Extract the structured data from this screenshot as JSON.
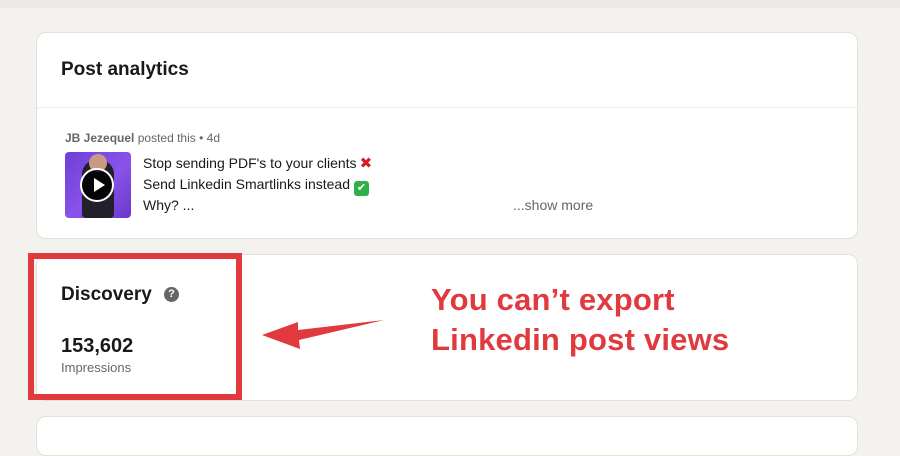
{
  "post_analytics": {
    "title": "Post analytics",
    "post": {
      "author": "JB Jezequel",
      "action": "posted this",
      "separator": "•",
      "age": "4d",
      "lines": [
        "Stop sending PDF's to your clients",
        "Send Linkedin Smartlinks instead",
        "Why? ..."
      ],
      "emoji_line1": "✖",
      "emoji_line2": "✔",
      "show_more": "...show more",
      "thumbnail_icon": "play-icon"
    }
  },
  "discovery": {
    "title": "Discovery",
    "help_icon": "?",
    "metric": {
      "value": "153,602",
      "label": "Impressions"
    }
  },
  "annotation": {
    "line1": "You can’t export",
    "line2": "Linkedin post views",
    "color": "#e0393e"
  }
}
